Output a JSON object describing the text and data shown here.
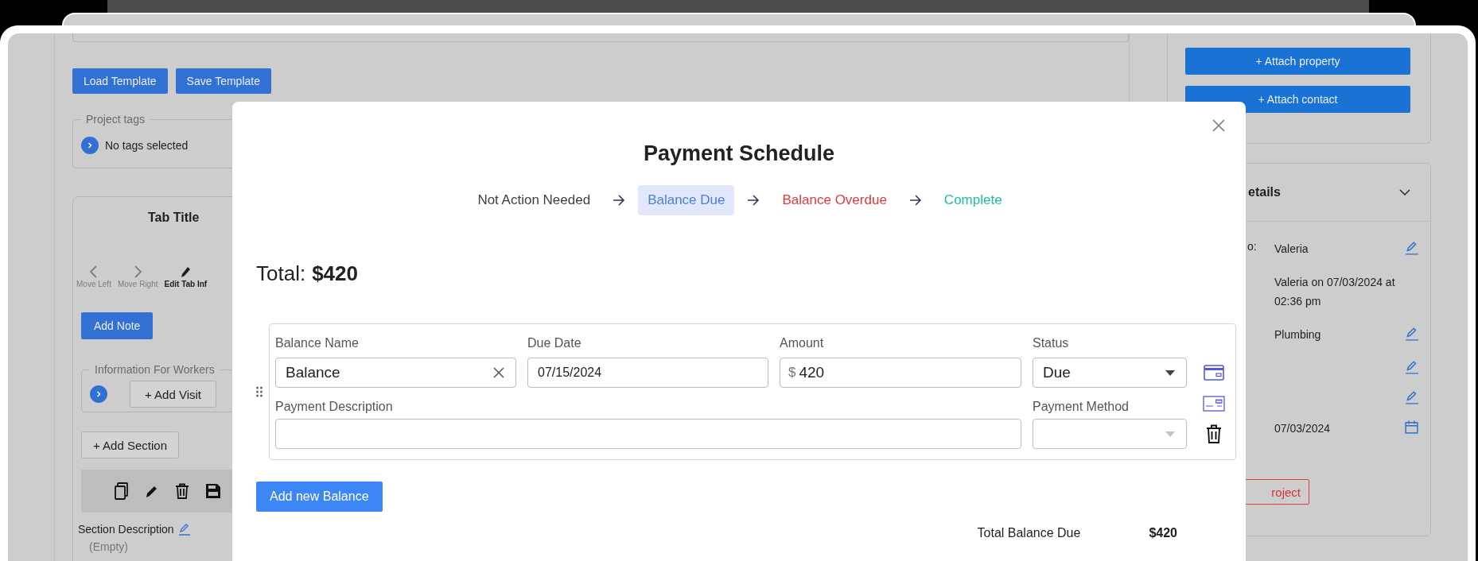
{
  "background": {
    "buttons": [
      "Load Template",
      "Save Template"
    ],
    "project_tags": {
      "legend": "Project tags",
      "value": "No tags selected"
    },
    "tab": {
      "title": "Tab Title",
      "actions": [
        {
          "label": "Move Left",
          "disabled": true
        },
        {
          "label": "Move Right",
          "disabled": true
        },
        {
          "label": "Edit Tab Inf",
          "disabled": false
        }
      ],
      "add_note": "Add Note",
      "workers": {
        "legend": "Information For Workers",
        "button": "+ Add Visit"
      },
      "add_section": "+ Add Section",
      "section": {
        "description_label": "Section Description",
        "description_value": "(Empty)"
      }
    },
    "attach_buttons": [
      "+ Attach property",
      "+ Attach contact"
    ],
    "details": {
      "title": "etails",
      "rows": [
        {
          "label": "o:",
          "value": "Valeria",
          "kind": "editable"
        },
        {
          "value": "Valeria on 07/03/2024 at 02:36 pm",
          "kind": "plain"
        },
        {
          "value": "Plumbing",
          "kind": "editable"
        },
        {
          "kind": "editable"
        },
        {
          "kind": "editable"
        },
        {
          "value": "07/03/2024",
          "kind": "date"
        }
      ],
      "button": "roject"
    }
  },
  "modal": {
    "title": "Payment Schedule",
    "steps": [
      {
        "label": "Not Action Needed",
        "color": "#3c4043",
        "selected": false
      },
      {
        "label": "Balance Due",
        "color": "#4a7fe0",
        "selected": true
      },
      {
        "label": "Balance Overdue",
        "color": "#e53935",
        "selected": false
      },
      {
        "label": "Complete",
        "color": "#1dbf9b",
        "selected": false
      }
    ],
    "total_label": "Total:",
    "total_value": "$420",
    "balances": [
      {
        "name_label": "Balance Name",
        "name": "Balance",
        "due_label": "Due Date",
        "due": "07/15/2024",
        "amount_label": "Amount",
        "currency": "$",
        "amount": "420",
        "status_label": "Status",
        "status": "Due",
        "description_label": "Payment Description",
        "method_label": "Payment Method"
      }
    ],
    "add_button": "Add new Balance",
    "summary": {
      "label": "Total Balance Due",
      "value": "$420"
    }
  }
}
